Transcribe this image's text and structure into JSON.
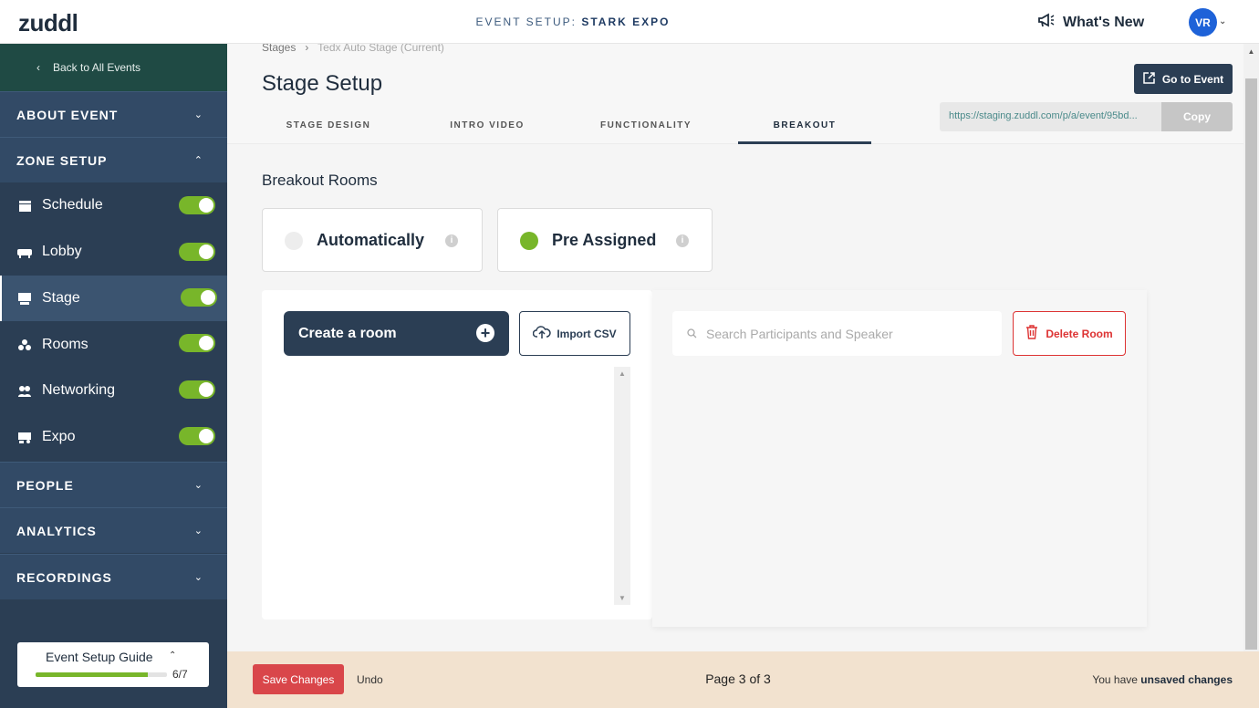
{
  "app": {
    "logo": "zuddl"
  },
  "topbar": {
    "event_prefix": "EVENT SETUP: ",
    "event_name": "STARK EXPO",
    "whats_new": "What's New",
    "avatar_initials": "VR"
  },
  "sidebar": {
    "back_label": "Back to All Events",
    "sections": {
      "about": "ABOUT EVENT",
      "zone_setup": "ZONE SETUP",
      "people": "PEOPLE",
      "analytics": "ANALYTICS",
      "recordings": "RECORDINGS"
    },
    "zone_items": [
      {
        "label": "Schedule",
        "enabled": true
      },
      {
        "label": "Lobby",
        "enabled": true
      },
      {
        "label": "Stage",
        "enabled": true
      },
      {
        "label": "Rooms",
        "enabled": true
      },
      {
        "label": "Networking",
        "enabled": true
      },
      {
        "label": "Expo",
        "enabled": true
      }
    ],
    "guide": {
      "title": "Event Setup Guide",
      "count": "6/7",
      "progress": 0.857
    }
  },
  "header": {
    "breadcrumb_root": "Stages",
    "breadcrumb_current": "Tedx Auto Stage (Current)",
    "title": "Stage Setup",
    "tabs": [
      "STAGE DESIGN",
      "INTRO VIDEO",
      "FUNCTIONALITY",
      "BREAKOUT"
    ],
    "active_tab": "BREAKOUT",
    "go_to_event": "Go to Event",
    "url": "https://staging.zuddl.com/p/a/event/95bd...",
    "copy": "Copy"
  },
  "breakout": {
    "heading": "Breakout Rooms",
    "option_auto": "Automatically",
    "option_pre": "Pre Assigned",
    "selected": "Pre Assigned",
    "create_room": "Create a room",
    "import_csv": "Import CSV",
    "search_placeholder": "Search Participants and Speaker",
    "delete_room": "Delete Room"
  },
  "footer": {
    "save": "Save Changes",
    "undo": "Undo",
    "page": "Page 3 of 3",
    "unsaved_prefix": "You have ",
    "unsaved_bold": "unsaved changes"
  },
  "colors": {
    "sidebar": "#2b3e54",
    "back_row": "#1f4a44",
    "accent_green": "#78b62a",
    "save_red": "#d9464a",
    "footer_bg": "#f2e2cf"
  }
}
